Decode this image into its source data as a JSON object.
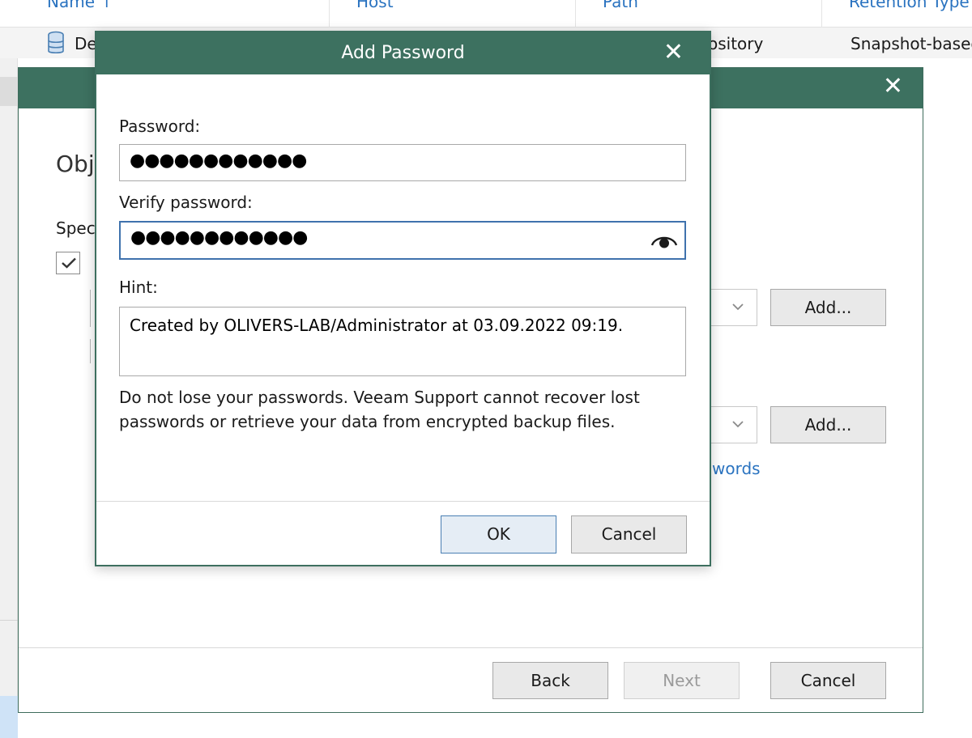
{
  "background": {
    "columns": [
      "Name ↑",
      "Host",
      "Path",
      "Retention Type"
    ],
    "row": {
      "name": "De",
      "path": "ository",
      "retention": "Snapshot-based"
    }
  },
  "wizard": {
    "heading": "Obj",
    "spec_label": "Spec",
    "add_button_1": "Add...",
    "add_button_2": "Add...",
    "link_fragment": "words",
    "footer": {
      "back": "Back",
      "next": "Next",
      "cancel": "Cancel"
    }
  },
  "modal": {
    "title": "Add Password",
    "password_label": "Password:",
    "password_value": "●●●●●●●●●●●●",
    "verify_label": "Verify password:",
    "verify_value": "●●●●●●●●●●●●",
    "hint_label": "Hint:",
    "hint_value": "Created by OLIVERS-LAB/Administrator at 03.09.2022 09:19.",
    "warning_line1": "Do not lose your passwords. Veeam Support cannot recover lost",
    "warning_line2": "passwords or retrieve your data from encrypted backup files.",
    "ok": "OK",
    "cancel": "Cancel"
  },
  "colors": {
    "titlebar": "#3d7160",
    "link": "#2a73c0",
    "focus": "#3f72ad"
  },
  "icons": {
    "close": "close-icon",
    "eye": "show-password-icon",
    "database": "database-icon",
    "checkbox": "checkmark-icon",
    "dropdown": "chevron-down-icon"
  }
}
